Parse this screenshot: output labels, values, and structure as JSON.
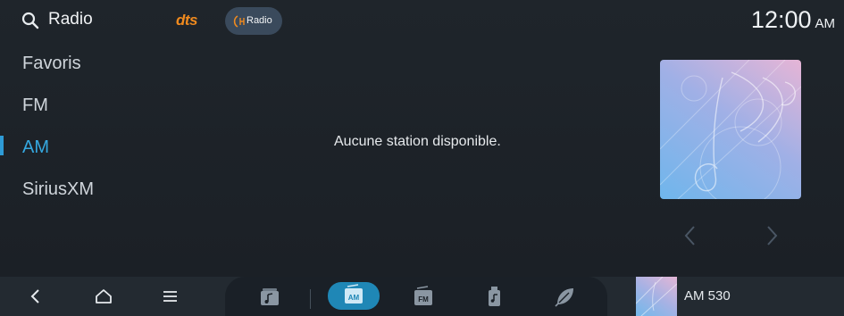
{
  "header": {
    "title": "Radio",
    "dts_logo": "dts",
    "hd_radio_label": "Radio",
    "clock_time": "12:00",
    "clock_ampm": "AM"
  },
  "sidebar": {
    "items": [
      {
        "label": "Favoris",
        "active": false
      },
      {
        "label": "FM",
        "active": false
      },
      {
        "label": "AM",
        "active": true
      },
      {
        "label": "SiriusXM",
        "active": false
      }
    ]
  },
  "main": {
    "empty_message": "Aucune station disponible."
  },
  "bottom_bar": {
    "system_buttons": [
      "back-icon",
      "home-icon",
      "menu-icon"
    ],
    "sources": [
      {
        "name": "media-icon",
        "active": false
      },
      {
        "name": "am-icon",
        "label": "AM",
        "active": true
      },
      {
        "name": "fm-icon",
        "label": "FM",
        "active": false
      },
      {
        "name": "usb-music-icon",
        "active": false
      },
      {
        "name": "leaf-icon",
        "active": false
      }
    ],
    "now_playing": "AM 530"
  },
  "colors": {
    "accent": "#35a8e0",
    "background": "#1e2329",
    "dts_orange": "#f08a1e"
  }
}
